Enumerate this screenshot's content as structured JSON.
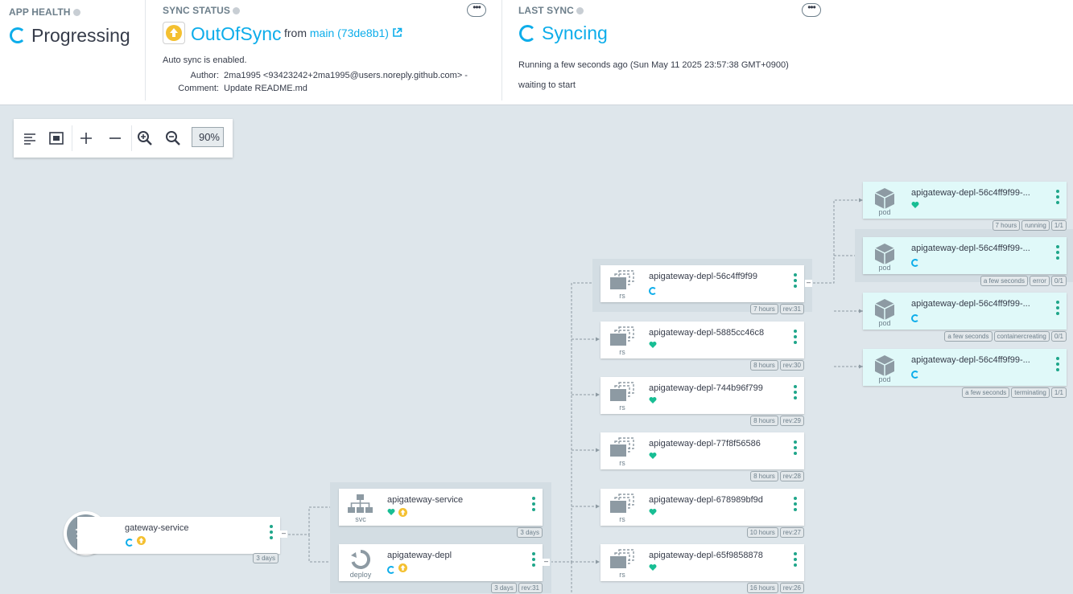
{
  "app_health": {
    "title": "APP HEALTH",
    "status": "Progressing"
  },
  "sync_status": {
    "title": "SYNC STATUS",
    "status": "OutOfSync",
    "from_label": "from",
    "revision": "main (73de8b1)",
    "auto_sync": "Auto sync is enabled.",
    "author_label": "Author:",
    "author": "2ma1995 <93423242+2ma1995@users.noreply.github.com> -",
    "comment_label": "Comment:",
    "comment": "Update README.md",
    "more": "•••"
  },
  "last_sync": {
    "title": "LAST SYNC",
    "status": "Syncing",
    "running": "Running a few seconds ago (Sun May 11 2025 23:57:38 GMT+0900)",
    "message": "waiting to start",
    "more": "•••"
  },
  "toolbar": {
    "zoom": "90%"
  },
  "colors": {
    "accent": "#0dadea",
    "healthy": "#18be94",
    "outofsync": "#f4c030",
    "progress": "#0dadea"
  },
  "nodes": {
    "app": {
      "name": "gateway-service",
      "tags": [
        "3 days"
      ]
    },
    "svc": {
      "name": "apigateway-service",
      "kind": "svc",
      "tags": [
        "3 days"
      ]
    },
    "deploy": {
      "name": "apigateway-depl",
      "kind": "deploy",
      "tags": [
        "3 days",
        "rev:31"
      ]
    },
    "rs": [
      {
        "name": "apigateway-depl-56c4ff9f99",
        "kind": "rs",
        "health": "progressing",
        "tags": [
          "7 hours",
          "rev:31"
        ]
      },
      {
        "name": "apigateway-depl-5885cc46c8",
        "kind": "rs",
        "health": "healthy",
        "tags": [
          "8 hours",
          "rev:30"
        ]
      },
      {
        "name": "apigateway-depl-744b96f799",
        "kind": "rs",
        "health": "healthy",
        "tags": [
          "8 hours",
          "rev:29"
        ]
      },
      {
        "name": "apigateway-depl-77f8f56586",
        "kind": "rs",
        "health": "healthy",
        "tags": [
          "8 hours",
          "rev:28"
        ]
      },
      {
        "name": "apigateway-depl-678989bf9d",
        "kind": "rs",
        "health": "healthy",
        "tags": [
          "10 hours",
          "rev:27"
        ]
      },
      {
        "name": "apigateway-depl-65f9858878",
        "kind": "rs",
        "health": "healthy",
        "tags": [
          "16 hours",
          "rev:26"
        ]
      }
    ],
    "pods": [
      {
        "name": "apigateway-depl-56c4ff9f99-...",
        "kind": "pod",
        "health": "healthy",
        "tags": [
          "7 hours",
          "running",
          "1/1"
        ]
      },
      {
        "name": "apigateway-depl-56c4ff9f99-...",
        "kind": "pod",
        "health": "progressing",
        "tags": [
          "a few seconds",
          "error",
          "0/1"
        ]
      },
      {
        "name": "apigateway-depl-56c4ff9f99-...",
        "kind": "pod",
        "health": "progressing",
        "tags": [
          "a few seconds",
          "containercreating",
          "0/1"
        ]
      },
      {
        "name": "apigateway-depl-56c4ff9f99-...",
        "kind": "pod",
        "health": "progressing",
        "tags": [
          "a few seconds",
          "terminating",
          "1/1"
        ]
      }
    ]
  }
}
